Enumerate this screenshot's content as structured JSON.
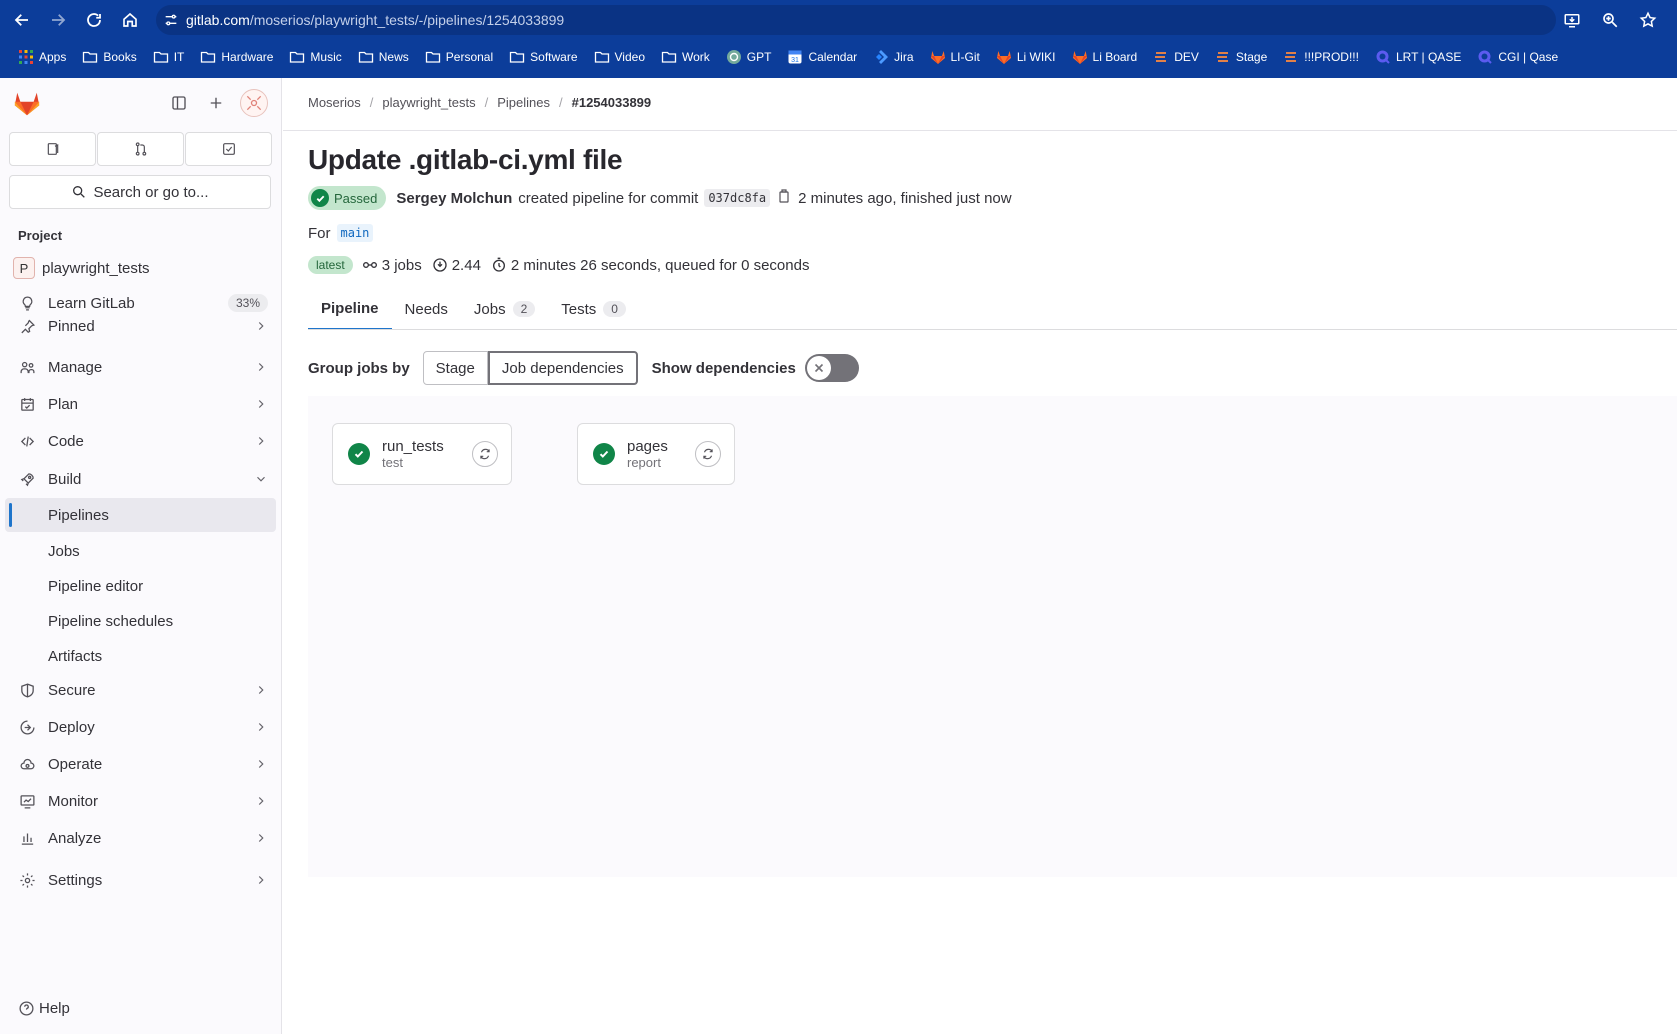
{
  "browser": {
    "url_domain": "gitlab.com",
    "url_path": "/moserios/playwright_tests/-/pipelines/1254033899",
    "bookmarks": [
      {
        "label": "Apps",
        "icon": "apps-grid-icon"
      },
      {
        "label": "Books",
        "icon": "folder-icon"
      },
      {
        "label": "IT",
        "icon": "folder-icon"
      },
      {
        "label": "Hardware",
        "icon": "folder-icon"
      },
      {
        "label": "Music",
        "icon": "folder-icon"
      },
      {
        "label": "News",
        "icon": "folder-icon"
      },
      {
        "label": "Personal",
        "icon": "folder-icon"
      },
      {
        "label": "Software",
        "icon": "folder-icon"
      },
      {
        "label": "Video",
        "icon": "folder-icon"
      },
      {
        "label": "Work",
        "icon": "folder-icon"
      },
      {
        "label": "GPT",
        "icon": "gpt-icon"
      },
      {
        "label": "Calendar",
        "icon": "calendar-icon"
      },
      {
        "label": "Jira",
        "icon": "jira-icon"
      },
      {
        "label": "LI-Git",
        "icon": "gitlab-icon"
      },
      {
        "label": "Li WIKI",
        "icon": "gitlab-icon"
      },
      {
        "label": "Li Board",
        "icon": "gitlab-icon"
      },
      {
        "label": "DEV",
        "icon": "lines-icon"
      },
      {
        "label": "Stage",
        "icon": "lines-icon"
      },
      {
        "label": "!!!PROD!!!",
        "icon": "lines-icon"
      },
      {
        "label": "LRT | QASE",
        "icon": "qase-icon"
      },
      {
        "label": "CGI | Qase",
        "icon": "qase-icon"
      }
    ]
  },
  "sidebar": {
    "search_label": "Search or go to...",
    "section_title": "Project",
    "project_name": "playwright_tests",
    "project_initial": "P",
    "learn_label": "Learn GitLab",
    "learn_pct": "33%",
    "items": [
      {
        "label": "Pinned"
      },
      {
        "label": "Manage"
      },
      {
        "label": "Plan"
      },
      {
        "label": "Code"
      },
      {
        "label": "Build"
      },
      {
        "label": "Pipelines"
      },
      {
        "label": "Jobs"
      },
      {
        "label": "Pipeline editor"
      },
      {
        "label": "Pipeline schedules"
      },
      {
        "label": "Artifacts"
      },
      {
        "label": "Secure"
      },
      {
        "label": "Deploy"
      },
      {
        "label": "Operate"
      },
      {
        "label": "Monitor"
      },
      {
        "label": "Analyze"
      },
      {
        "label": "Settings"
      }
    ],
    "help_label": "Help"
  },
  "breadcrumb": [
    "Moserios",
    "playwright_tests",
    "Pipelines",
    "#1254033899"
  ],
  "pipeline": {
    "title": "Update .gitlab-ci.yml file",
    "status": "Passed",
    "author": "Sergey Molchun",
    "created_text": "created pipeline for commit",
    "commit": "037dc8fa",
    "time_text": "2 minutes ago, finished just now",
    "for_label": "For",
    "branch": "main",
    "latest_label": "latest",
    "jobs_text": "3 jobs",
    "compute_text": "2.44",
    "duration_text": "2 minutes 26 seconds, queued for 0 seconds"
  },
  "tabs": [
    {
      "label": "Pipeline",
      "count": ""
    },
    {
      "label": "Needs",
      "count": ""
    },
    {
      "label": "Jobs",
      "count": "2"
    },
    {
      "label": "Tests",
      "count": "0"
    }
  ],
  "group_by": {
    "label": "Group jobs by",
    "options": [
      "Stage",
      "Job dependencies"
    ],
    "selected": "Job dependencies",
    "show_dependencies_label": "Show dependencies",
    "show_dependencies_on": false
  },
  "jobs": [
    {
      "name": "run_tests",
      "stage": "test",
      "status": "passed"
    },
    {
      "name": "pages",
      "stage": "report",
      "status": "passed"
    }
  ],
  "colors": {
    "chrome_bg": "#0c3d9a",
    "success": "#108548",
    "accent": "#1f75cb"
  }
}
